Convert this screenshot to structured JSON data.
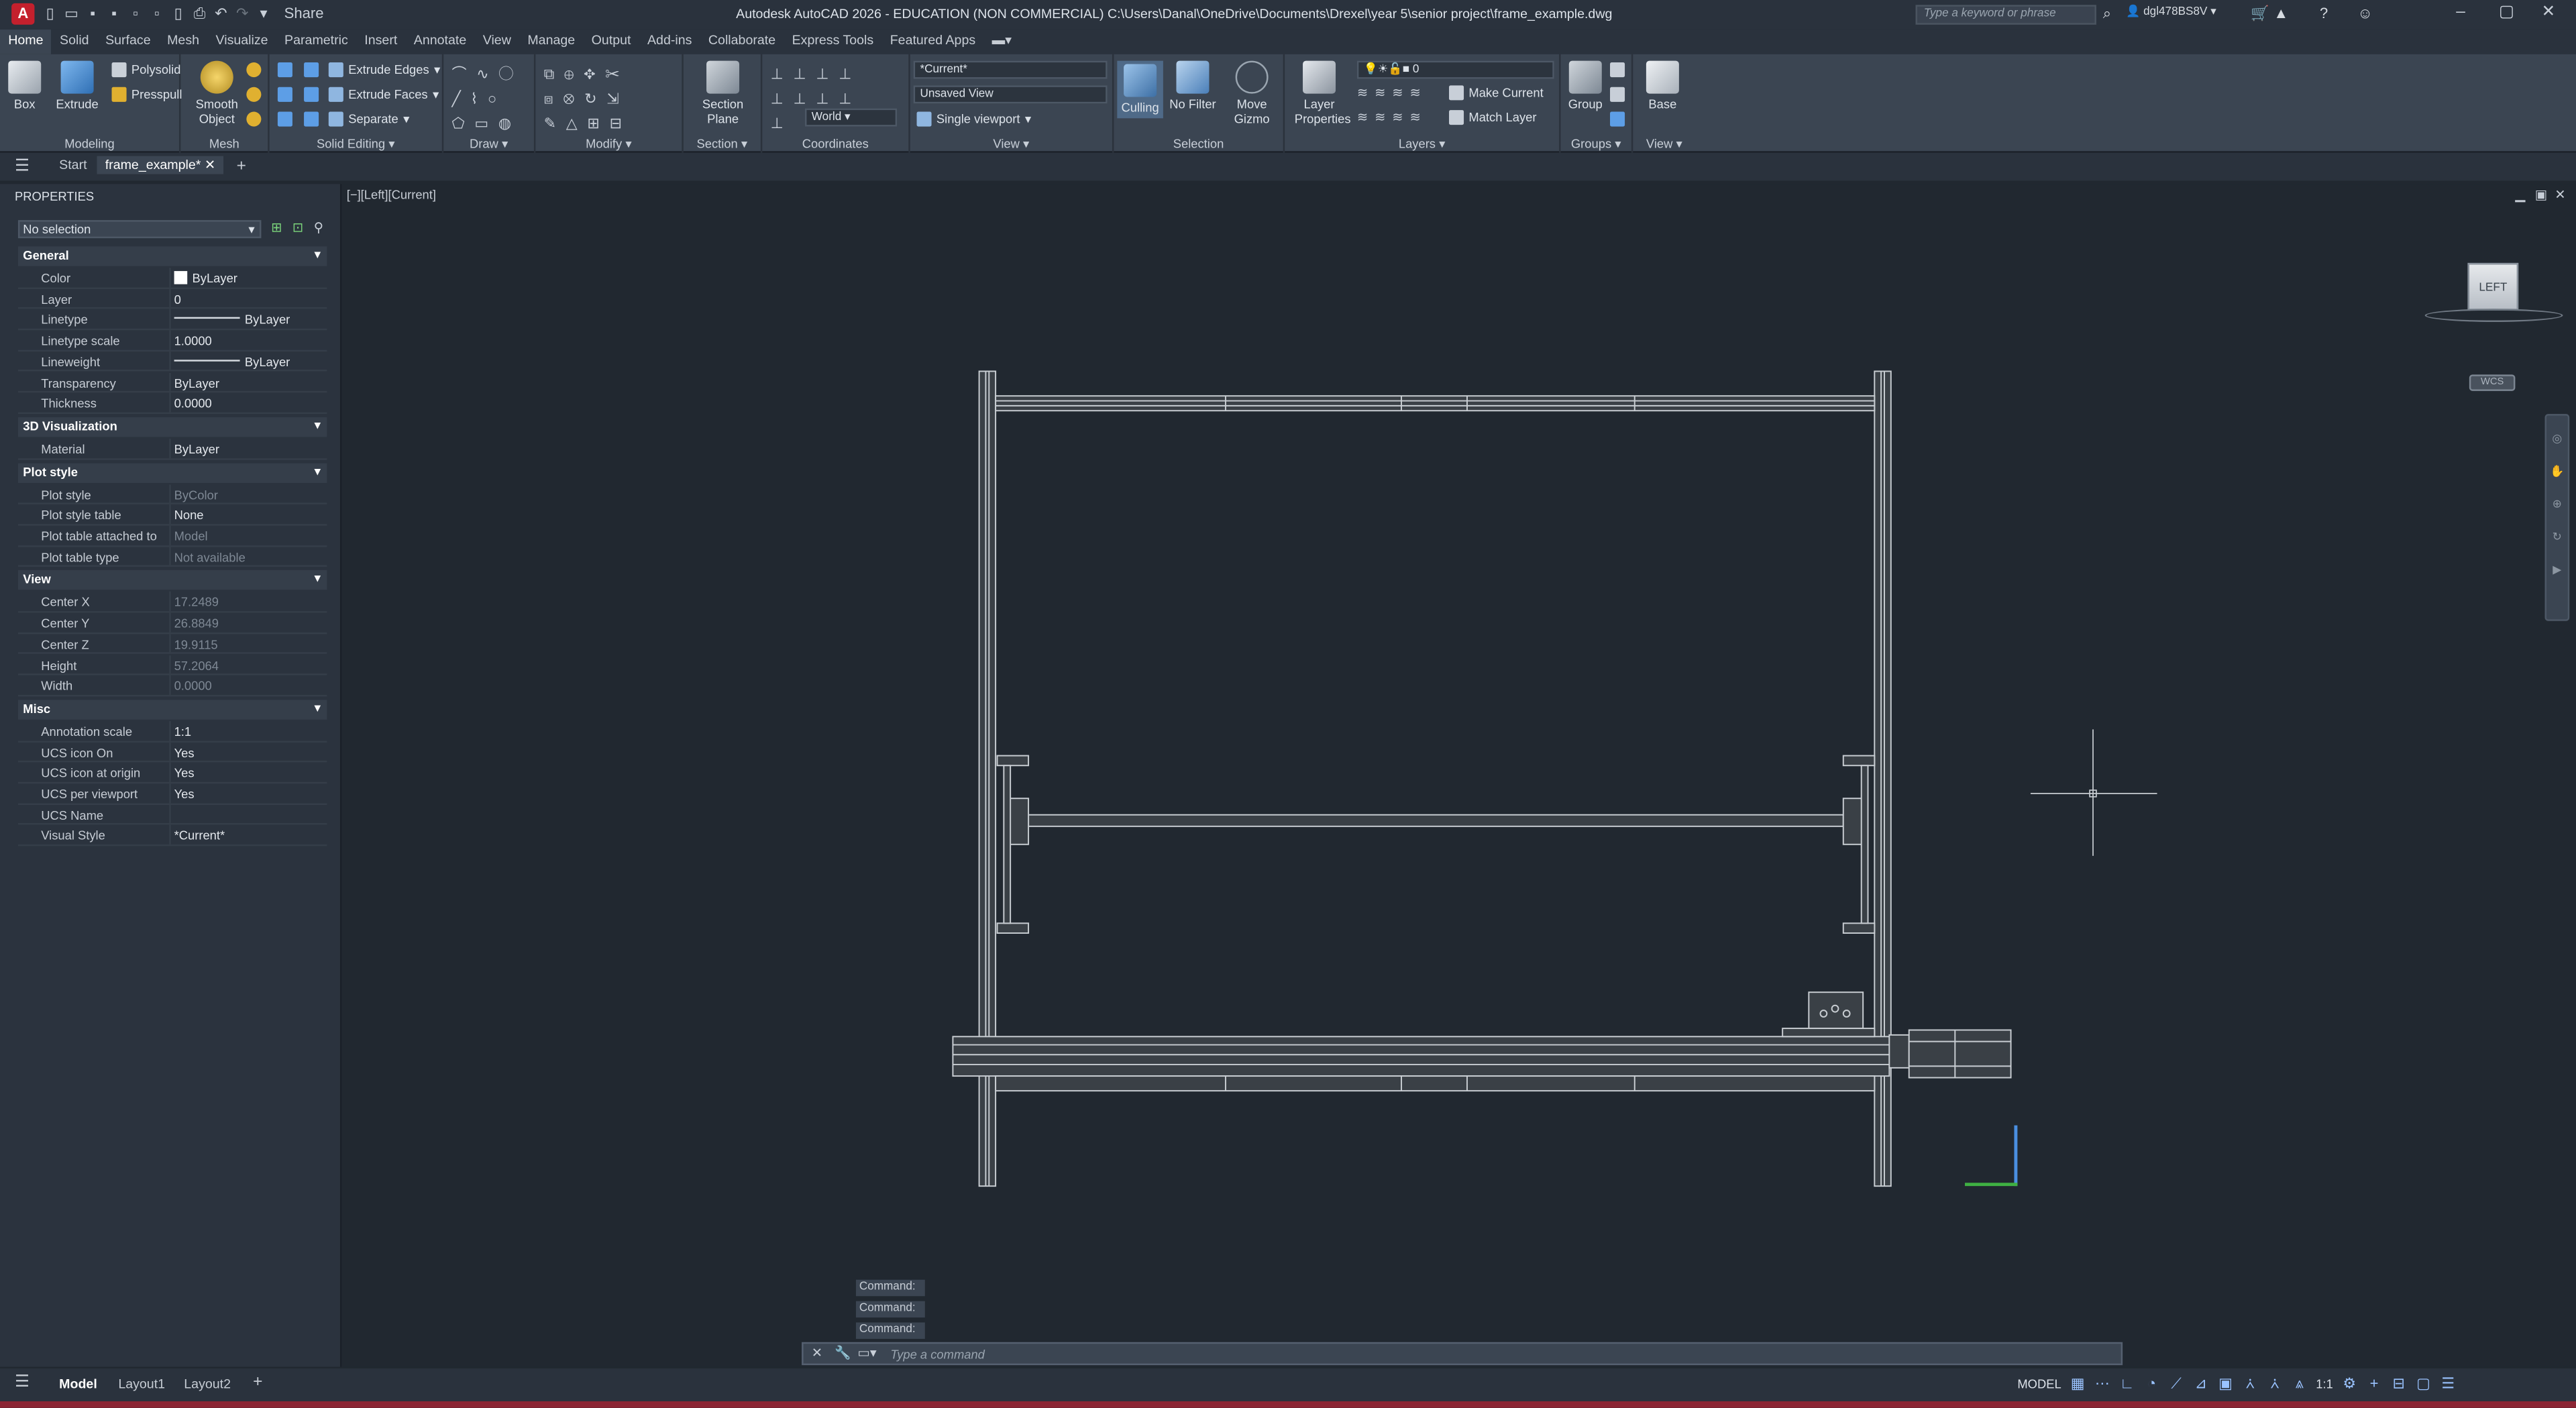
{
  "titlebar": {
    "title": "Autodesk AutoCAD 2026 - EDUCATION (NON COMMERCIAL)   C:\\Users\\Danal\\OneDrive\\Documents\\Drexel\\year 5\\senior project\\frame_example.dwg",
    "logo": "A",
    "share": "Share",
    "search_placeholder": "Type a keyword or phrase",
    "user": "dgl478BS8V"
  },
  "menu": {
    "tabs": [
      "Home",
      "Solid",
      "Surface",
      "Mesh",
      "Visualize",
      "Parametric",
      "Insert",
      "Annotate",
      "View",
      "Manage",
      "Output",
      "Add-ins",
      "Collaborate",
      "Express Tools",
      "Featured Apps"
    ]
  },
  "ribbon": {
    "modeling": {
      "title": "Modeling",
      "box": "Box",
      "extrude": "Extrude",
      "polysolid": "Polysolid",
      "presspull": "Presspull"
    },
    "mesh": {
      "title": "Mesh",
      "smooth": "Smooth\nObject"
    },
    "solid_editing": {
      "title": "Solid Editing",
      "extrude_edges": "Extrude Edges",
      "extrude_faces": "Extrude Faces",
      "separate": "Separate"
    },
    "draw": {
      "title": "Draw"
    },
    "modify": {
      "title": "Modify"
    },
    "section": {
      "title": "Section",
      "section_plane": "Section\nPlane"
    },
    "coordinates": {
      "title": "Coordinates",
      "world": "World"
    },
    "view": {
      "title": "View",
      "current": "*Current*",
      "unsaved_view": "Unsaved View",
      "single_viewport": "Single viewport"
    },
    "selection": {
      "title": "Selection",
      "culling": "Culling",
      "no_filter": "No Filter",
      "move_gizmo": "Move\nGizmo"
    },
    "layers": {
      "title": "Layers",
      "layer_properties": "Layer\nProperties",
      "layer_value": "0",
      "make_current": "Make Current",
      "match_layer": "Match Layer"
    },
    "groups": {
      "title": "Groups",
      "group": "Group"
    },
    "view2": {
      "title": "View",
      "base": "Base"
    }
  },
  "doctabs": {
    "start": "Start",
    "file": "frame_example*"
  },
  "properties": {
    "title": "PROPERTIES",
    "selection": "No selection",
    "general": {
      "title": "General",
      "rows": [
        [
          "Color",
          "ByLayer"
        ],
        [
          "Layer",
          "0"
        ],
        [
          "Linetype",
          "ByLayer"
        ],
        [
          "Linetype scale",
          "1.0000"
        ],
        [
          "Lineweight",
          "ByLayer"
        ],
        [
          "Transparency",
          "ByLayer"
        ],
        [
          "Thickness",
          "0.0000"
        ]
      ]
    },
    "viz": {
      "title": "3D Visualization",
      "rows": [
        [
          "Material",
          "ByLayer"
        ]
      ]
    },
    "plot": {
      "title": "Plot style",
      "rows": [
        [
          "Plot style",
          "ByColor"
        ],
        [
          "Plot style table",
          "None"
        ],
        [
          "Plot table attached to",
          "Model"
        ],
        [
          "Plot table type",
          "Not available"
        ]
      ]
    },
    "view": {
      "title": "View",
      "rows": [
        [
          "Center X",
          "17.2489"
        ],
        [
          "Center Y",
          "26.8849"
        ],
        [
          "Center Z",
          "19.9115"
        ],
        [
          "Height",
          "57.2064"
        ],
        [
          "Width",
          "0.0000"
        ]
      ]
    },
    "misc": {
      "title": "Misc",
      "rows": [
        [
          "Annotation scale",
          "1:1"
        ],
        [
          "UCS icon On",
          "Yes"
        ],
        [
          "UCS icon at origin",
          "Yes"
        ],
        [
          "UCS per viewport",
          "Yes"
        ],
        [
          "UCS Name",
          ""
        ],
        [
          "Visual Style",
          "*Current*"
        ]
      ]
    }
  },
  "viewport": {
    "label": "[−][Left][Current]",
    "viewcube": "LEFT",
    "wcs": "WCS"
  },
  "command": {
    "history": [
      "Command:",
      "Command:",
      "Command:"
    ],
    "placeholder": "Type a command"
  },
  "status": {
    "model_tab": "Model",
    "layout1": "Layout1",
    "layout2": "Layout2",
    "model": "MODEL",
    "scale": "1:1"
  }
}
